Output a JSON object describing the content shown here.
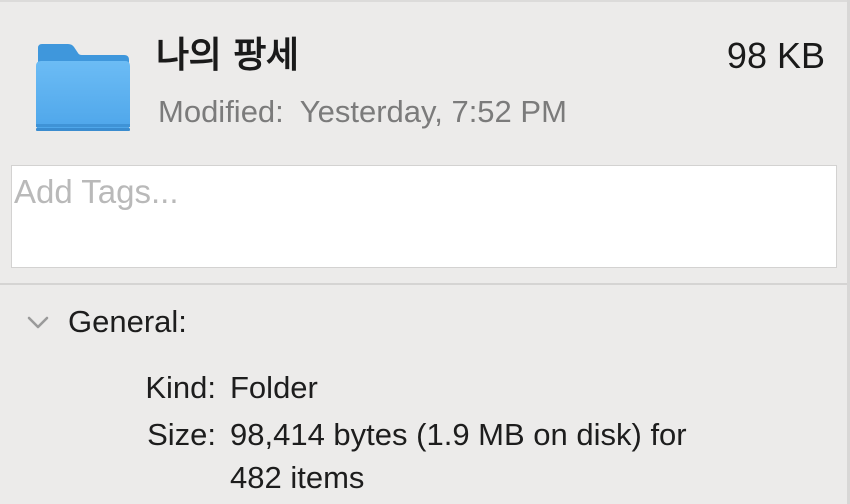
{
  "header": {
    "file_name": "나의 팡세",
    "file_size": "98 KB",
    "modified_label": "Modified:",
    "modified_value": "Yesterday, 7:52 PM",
    "icon": "folder-icon"
  },
  "tags": {
    "placeholder": "Add Tags...",
    "value": ""
  },
  "general": {
    "title": "General:",
    "expanded": true,
    "kind_label": "Kind:",
    "kind_value": "Folder",
    "size_label": "Size:",
    "size_value_line1": "98,414 bytes (1.9 MB on disk) for",
    "size_value_line2": "482 items"
  },
  "colors": {
    "background": "#ecebea",
    "folder_blue": "#5fb2ef",
    "secondary_text": "#7b7b7b",
    "placeholder_text": "#b9b9b9"
  }
}
